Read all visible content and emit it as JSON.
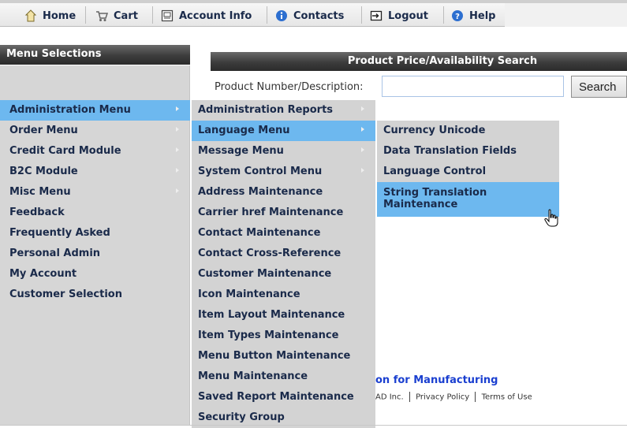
{
  "toolbar": {
    "items": [
      {
        "label": "Home",
        "icon": "home-icon"
      },
      {
        "label": "Cart",
        "icon": "cart-icon"
      },
      {
        "label": "Account Info",
        "icon": "account-info-icon"
      },
      {
        "label": "Contacts",
        "icon": "contacts-info-icon"
      },
      {
        "label": "Logout",
        "icon": "logout-icon"
      },
      {
        "label": "Help",
        "icon": "help-icon"
      }
    ]
  },
  "sidebar": {
    "title": "Menu Selections",
    "items": [
      {
        "label": "Administration Menu",
        "has_submenu": true,
        "active": true
      },
      {
        "label": "Order Menu",
        "has_submenu": true
      },
      {
        "label": "Credit Card Module",
        "has_submenu": true
      },
      {
        "label": "B2C Module",
        "has_submenu": true
      },
      {
        "label": "Misc Menu",
        "has_submenu": true
      },
      {
        "label": "Feedback"
      },
      {
        "label": "Frequently Asked"
      },
      {
        "label": "Personal Admin"
      },
      {
        "label": "My Account"
      },
      {
        "label": "Customer Selection"
      }
    ]
  },
  "search": {
    "title": "Product Price/Availability Search",
    "label": "Product Number/Description:",
    "value": "",
    "button_label": "Search"
  },
  "admin_submenu": {
    "items": [
      {
        "label": "Administration Reports",
        "has_submenu": true
      },
      {
        "label": "Language Menu",
        "has_submenu": true,
        "active": true
      },
      {
        "label": "Message Menu",
        "has_submenu": true
      },
      {
        "label": "System Control Menu",
        "has_submenu": true
      },
      {
        "label": "Address Maintenance"
      },
      {
        "label": "Carrier href Maintenance"
      },
      {
        "label": "Contact Maintenance"
      },
      {
        "label": "Contact Cross-Reference"
      },
      {
        "label": "Customer Maintenance"
      },
      {
        "label": "Icon Maintenance"
      },
      {
        "label": "Item Layout Maintenance"
      },
      {
        "label": "Item Types Maintenance"
      },
      {
        "label": "Menu Button Maintenance"
      },
      {
        "label": "Menu Maintenance"
      },
      {
        "label": "Saved Report Maintenance"
      },
      {
        "label": "Security Group"
      }
    ]
  },
  "language_submenu": {
    "items": [
      {
        "label": "Currency Unicode"
      },
      {
        "label": "Data Translation Fields"
      },
      {
        "label": "Language Control"
      },
      {
        "label": "String Translation Maintenance",
        "active": true
      }
    ]
  },
  "footer": {
    "title": "on for Manufacturing",
    "company": "AD Inc.",
    "privacy_link": "Privacy Policy",
    "terms_link": "Terms of Use"
  },
  "colors": {
    "highlight": "#6db8ef",
    "menu_bg": "#d3d3d3",
    "header_dark": "#3c3c3c",
    "footer_link": "#1a3fd0"
  }
}
